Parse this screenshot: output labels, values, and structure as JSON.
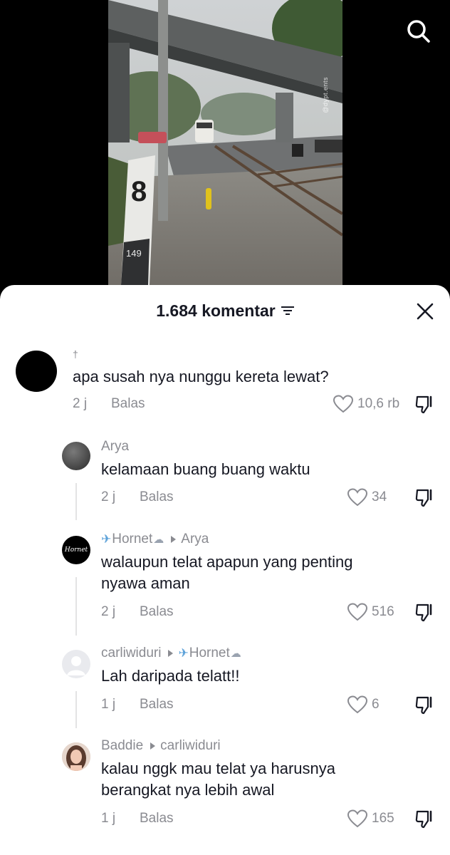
{
  "video": {
    "watermark": "@dypt.ents",
    "marker_number": "8",
    "post_number": "149"
  },
  "sheet": {
    "comment_count": "1.684 komentar"
  },
  "comments": [
    {
      "username": "",
      "badge": "†",
      "text_lines": [
        "apa susah nya nunggu kereta lewat?"
      ],
      "time": "2 j",
      "reply_label": "Balas",
      "likes": "10,6 rb"
    },
    {
      "username": "Arya",
      "text_lines": [
        "kelamaan buang buang waktu"
      ],
      "time": "2 j",
      "reply_label": "Balas",
      "likes": "34"
    },
    {
      "username": "Hornet",
      "reply_to": "Arya",
      "avatar_text": "Hornet",
      "text_lines": [
        "walaupun telat apapun yang penting",
        "nyawa aman"
      ],
      "time": "2 j",
      "reply_label": "Balas",
      "likes": "516"
    },
    {
      "username": "carliwiduri",
      "reply_to": "Hornet",
      "text_lines": [
        "Lah daripada telatt!!"
      ],
      "time": "1 j",
      "reply_label": "Balas",
      "likes": "6"
    },
    {
      "username": "Baddie",
      "reply_to": "carliwiduri",
      "text_lines": [
        "kalau nggk mau telat ya harusnya",
        "berangkat nya lebih awal"
      ],
      "time": "1 j",
      "reply_label": "Balas",
      "likes": "165"
    }
  ],
  "icons": {
    "search": "search-icon",
    "filter": "filter-icon",
    "close": "close-icon",
    "like": "heart-icon",
    "dislike": "thumbs-down-icon",
    "airplane": "airplane-icon",
    "cloud": "cloud-icon"
  },
  "colors": {
    "text": "#161823",
    "muted": "#8a8b91",
    "sheet_bg": "#ffffff",
    "backdrop": "#000000"
  }
}
